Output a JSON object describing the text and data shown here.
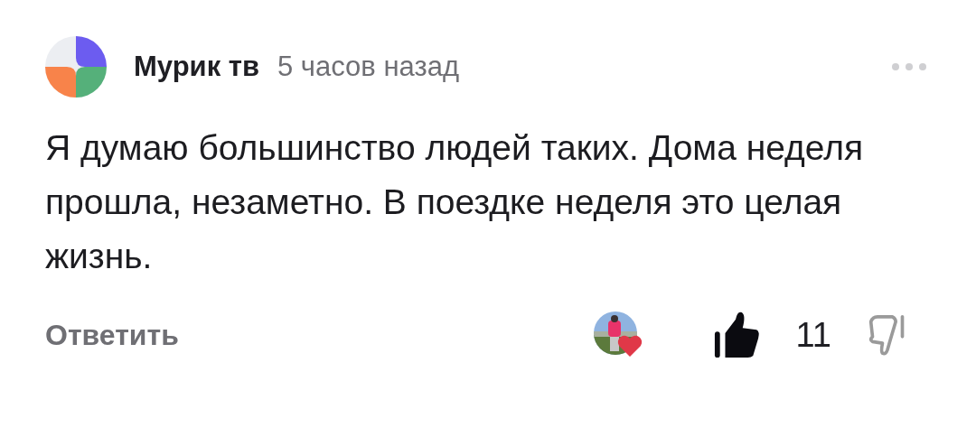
{
  "comment": {
    "author": "Мурик тв",
    "time": "5 часов назад",
    "text": "Я думаю большинство людей таких. Дома неделя прошла, незаметно. В поездке неделя это целая жизнь.",
    "reply": "Ответить",
    "likes": "11",
    "liked": true,
    "disliked": false
  }
}
